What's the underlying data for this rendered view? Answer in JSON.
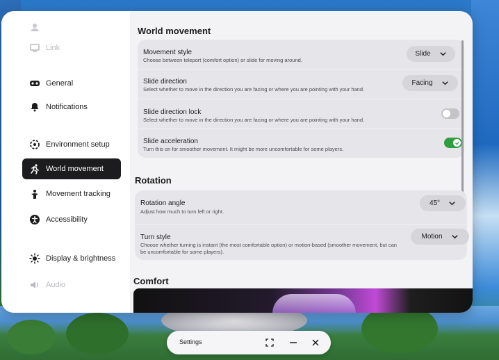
{
  "sidebar": {
    "items": [
      {
        "label": "",
        "icon": "account-icon",
        "state": "dim"
      },
      {
        "label": "Link",
        "icon": "link-icon",
        "state": "dim"
      },
      {
        "label": "General",
        "icon": "headset-icon",
        "state": "normal"
      },
      {
        "label": "Notifications",
        "icon": "bell-icon",
        "state": "normal"
      },
      {
        "label": "Environment setup",
        "icon": "environment-icon",
        "state": "normal"
      },
      {
        "label": "World movement",
        "icon": "running-icon",
        "state": "active"
      },
      {
        "label": "Movement tracking",
        "icon": "tracking-icon",
        "state": "normal"
      },
      {
        "label": "Accessibility",
        "icon": "accessibility-icon",
        "state": "normal"
      },
      {
        "label": "Display & brightness",
        "icon": "sun-icon",
        "state": "normal"
      },
      {
        "label": "Audio",
        "icon": "speaker-icon",
        "state": "dim"
      }
    ]
  },
  "world_movement": {
    "title": "World movement",
    "rows": [
      {
        "title": "Movement style",
        "desc": "Choose between teleport (comfort option) or slide for moving around.",
        "control": "dropdown",
        "value": "Slide"
      },
      {
        "title": "Slide direction",
        "desc": "Select whether to move in the direction you are facing or where you are pointing with your hand.",
        "control": "dropdown",
        "value": "Facing"
      },
      {
        "title": "Slide direction lock",
        "desc": "Select whether to move in the direction you are facing or where you are pointing with your hand.",
        "control": "toggle",
        "value": "off"
      },
      {
        "title": "Slide acceleration",
        "desc": "Turn this on for smoother movement. It might be more uncomfortable for some players.",
        "control": "toggle",
        "value": "on"
      }
    ]
  },
  "rotation": {
    "title": "Rotation",
    "rows": [
      {
        "title": "Rotation angle",
        "desc": "Adjust how much to turn left or right.",
        "control": "dropdown",
        "value": "45°"
      },
      {
        "title": "Turn style",
        "desc": "Choose whether turning is instant (the most comfortable option) or motion-based (smoother movement, but can be uncomfortable for some players).",
        "control": "dropdown",
        "value": "Motion"
      }
    ]
  },
  "comfort": {
    "title": "Comfort"
  },
  "taskbar": {
    "title": "Settings"
  },
  "colors": {
    "toggle_on": "#2e9e3e",
    "active_nav": "#1c1c1e",
    "panel_bg": "#f3f3f5",
    "card_bg": "#e6e6ea"
  }
}
